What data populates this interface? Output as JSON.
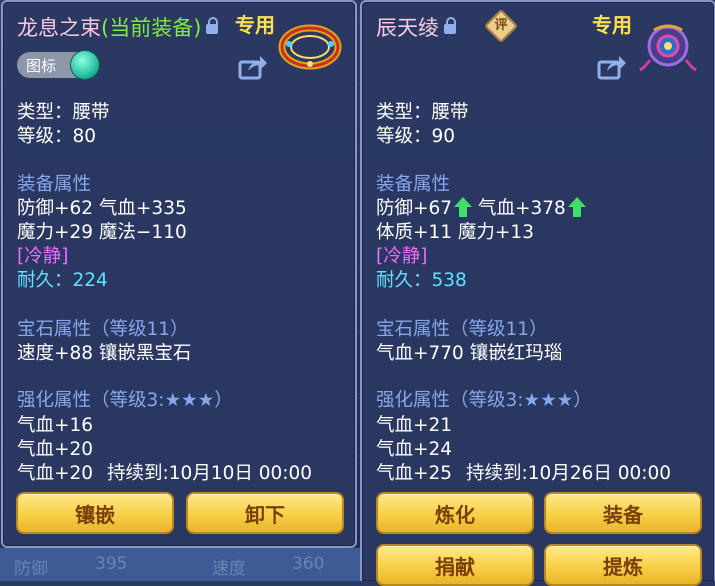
{
  "left_card": {
    "title": "龙息之束",
    "title_suffix": "(当前装备)",
    "exclusive": "专用",
    "toggle_label": "图标",
    "type_line": "类型：腰带",
    "level_line": "等级：80",
    "equip_attr_title": "装备属性",
    "attr_line1": "防御+62 气血+335",
    "attr_line2": "魔力+29 魔法−110",
    "special": "[冷静]",
    "durability": "耐久：224",
    "gem_title": "宝石属性（等级11）",
    "gem_line": "速度+88 镶嵌黑宝石",
    "enh_title": "强化属性（等级3:★★★）",
    "enh_line1": "气血+16",
    "enh_line2": "气血+20",
    "enh_line3": "气血+20",
    "expire": "持续到:10月10日 00:00",
    "buttons": [
      "镶嵌",
      "卸下"
    ]
  },
  "right_card": {
    "title": "辰天绫",
    "badge": "评",
    "exclusive": "专用",
    "type_line": "类型：腰带",
    "level_line": "等级：90",
    "equip_attr_title": "装备属性",
    "attr_line1_a": "防御+67",
    "attr_line1_b": "气血+378",
    "attr_line2": "体质+11 魔力+13",
    "special": "[冷静]",
    "durability": "耐久：538",
    "gem_title": "宝石属性（等级11）",
    "gem_line": "气血+770 镶嵌红玛瑙",
    "enh_title": "强化属性（等级3:★★★）",
    "enh_line1": "气血+21",
    "enh_line2": "气血+24",
    "enh_line3": "气血+25",
    "expire": "持续到:10月26日 00:00",
    "buttons": [
      "炼化",
      "装备",
      "捐献",
      "提炼"
    ]
  },
  "background": {
    "defense_label": "防御",
    "defense_value": "395",
    "speed_label": "速度",
    "speed_value": "360"
  },
  "colors": {
    "title_pink": "#f7c9e1",
    "current_green": "#7dec3c",
    "exclusive_yellow": "#ffe14d",
    "section_blue": "#87a7ec",
    "special_purple": "#ef6dff",
    "durability_cyan": "#5fe3ff",
    "button_gold": "#f8cf47",
    "up_arrow_green": "#3fe06a"
  }
}
